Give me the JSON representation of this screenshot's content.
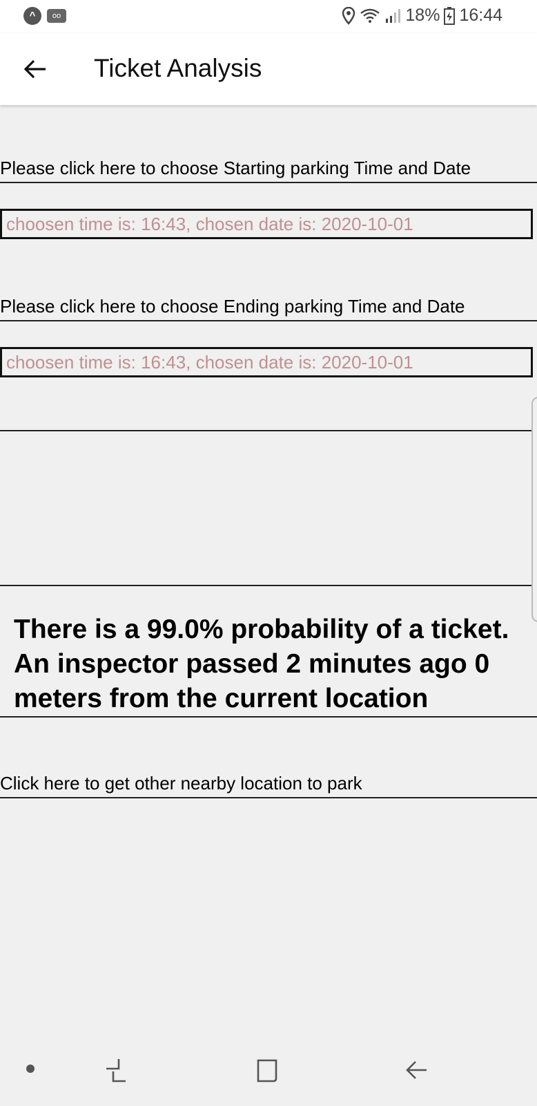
{
  "status_bar": {
    "battery": "18%",
    "time": "16:44"
  },
  "app_bar": {
    "title": "Ticket Analysis",
    "back_icon": "arrow-left-icon"
  },
  "start": {
    "link_label": "Please click here to choose Starting parking Time and Date",
    "chosen_text": "choosen time is: 16:43, chosen date is: 2020-10-01"
  },
  "end": {
    "link_label": "Please click here to choose Ending parking Time and Date",
    "chosen_text": "choosen time is: 16:43, chosen date is: 2020-10-01"
  },
  "result": {
    "text": "There is a 99.0% probability of a ticket. An inspector passed 2 minutes ago 0 meters from the current location"
  },
  "nearby_link": "Click here to get other nearby location to park",
  "nav_bar": {
    "dot_icon": "dot-icon",
    "recents_icon": "recent-apps-icon",
    "home_icon": "home-icon",
    "back_icon": "back-icon"
  },
  "colors": {
    "chosen_text": "#c09090",
    "background": "#f0f0f0"
  }
}
